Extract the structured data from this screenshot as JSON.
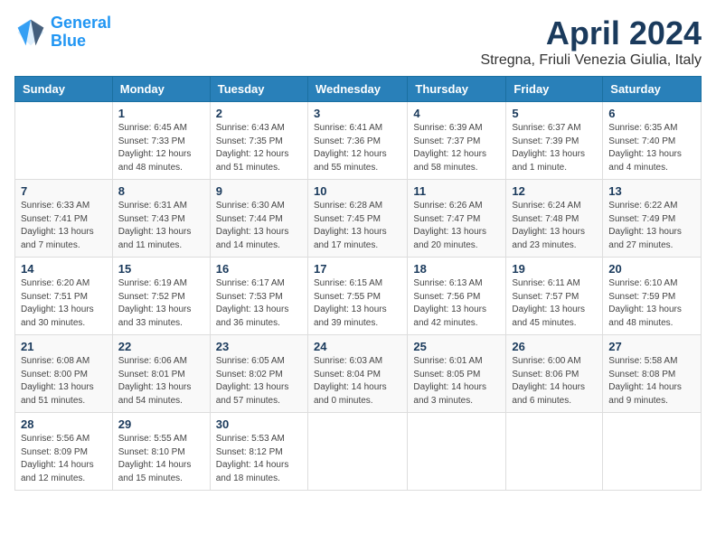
{
  "header": {
    "logo_line1": "General",
    "logo_line2": "Blue",
    "month_title": "April 2024",
    "subtitle": "Stregna, Friuli Venezia Giulia, Italy"
  },
  "weekdays": [
    "Sunday",
    "Monday",
    "Tuesday",
    "Wednesday",
    "Thursday",
    "Friday",
    "Saturday"
  ],
  "weeks": [
    [
      {
        "day": "",
        "sunrise": "",
        "sunset": "",
        "daylight": ""
      },
      {
        "day": "1",
        "sunrise": "Sunrise: 6:45 AM",
        "sunset": "Sunset: 7:33 PM",
        "daylight": "Daylight: 12 hours and 48 minutes."
      },
      {
        "day": "2",
        "sunrise": "Sunrise: 6:43 AM",
        "sunset": "Sunset: 7:35 PM",
        "daylight": "Daylight: 12 hours and 51 minutes."
      },
      {
        "day": "3",
        "sunrise": "Sunrise: 6:41 AM",
        "sunset": "Sunset: 7:36 PM",
        "daylight": "Daylight: 12 hours and 55 minutes."
      },
      {
        "day": "4",
        "sunrise": "Sunrise: 6:39 AM",
        "sunset": "Sunset: 7:37 PM",
        "daylight": "Daylight: 12 hours and 58 minutes."
      },
      {
        "day": "5",
        "sunrise": "Sunrise: 6:37 AM",
        "sunset": "Sunset: 7:39 PM",
        "daylight": "Daylight: 13 hours and 1 minute."
      },
      {
        "day": "6",
        "sunrise": "Sunrise: 6:35 AM",
        "sunset": "Sunset: 7:40 PM",
        "daylight": "Daylight: 13 hours and 4 minutes."
      }
    ],
    [
      {
        "day": "7",
        "sunrise": "Sunrise: 6:33 AM",
        "sunset": "Sunset: 7:41 PM",
        "daylight": "Daylight: 13 hours and 7 minutes."
      },
      {
        "day": "8",
        "sunrise": "Sunrise: 6:31 AM",
        "sunset": "Sunset: 7:43 PM",
        "daylight": "Daylight: 13 hours and 11 minutes."
      },
      {
        "day": "9",
        "sunrise": "Sunrise: 6:30 AM",
        "sunset": "Sunset: 7:44 PM",
        "daylight": "Daylight: 13 hours and 14 minutes."
      },
      {
        "day": "10",
        "sunrise": "Sunrise: 6:28 AM",
        "sunset": "Sunset: 7:45 PM",
        "daylight": "Daylight: 13 hours and 17 minutes."
      },
      {
        "day": "11",
        "sunrise": "Sunrise: 6:26 AM",
        "sunset": "Sunset: 7:47 PM",
        "daylight": "Daylight: 13 hours and 20 minutes."
      },
      {
        "day": "12",
        "sunrise": "Sunrise: 6:24 AM",
        "sunset": "Sunset: 7:48 PM",
        "daylight": "Daylight: 13 hours and 23 minutes."
      },
      {
        "day": "13",
        "sunrise": "Sunrise: 6:22 AM",
        "sunset": "Sunset: 7:49 PM",
        "daylight": "Daylight: 13 hours and 27 minutes."
      }
    ],
    [
      {
        "day": "14",
        "sunrise": "Sunrise: 6:20 AM",
        "sunset": "Sunset: 7:51 PM",
        "daylight": "Daylight: 13 hours and 30 minutes."
      },
      {
        "day": "15",
        "sunrise": "Sunrise: 6:19 AM",
        "sunset": "Sunset: 7:52 PM",
        "daylight": "Daylight: 13 hours and 33 minutes."
      },
      {
        "day": "16",
        "sunrise": "Sunrise: 6:17 AM",
        "sunset": "Sunset: 7:53 PM",
        "daylight": "Daylight: 13 hours and 36 minutes."
      },
      {
        "day": "17",
        "sunrise": "Sunrise: 6:15 AM",
        "sunset": "Sunset: 7:55 PM",
        "daylight": "Daylight: 13 hours and 39 minutes."
      },
      {
        "day": "18",
        "sunrise": "Sunrise: 6:13 AM",
        "sunset": "Sunset: 7:56 PM",
        "daylight": "Daylight: 13 hours and 42 minutes."
      },
      {
        "day": "19",
        "sunrise": "Sunrise: 6:11 AM",
        "sunset": "Sunset: 7:57 PM",
        "daylight": "Daylight: 13 hours and 45 minutes."
      },
      {
        "day": "20",
        "sunrise": "Sunrise: 6:10 AM",
        "sunset": "Sunset: 7:59 PM",
        "daylight": "Daylight: 13 hours and 48 minutes."
      }
    ],
    [
      {
        "day": "21",
        "sunrise": "Sunrise: 6:08 AM",
        "sunset": "Sunset: 8:00 PM",
        "daylight": "Daylight: 13 hours and 51 minutes."
      },
      {
        "day": "22",
        "sunrise": "Sunrise: 6:06 AM",
        "sunset": "Sunset: 8:01 PM",
        "daylight": "Daylight: 13 hours and 54 minutes."
      },
      {
        "day": "23",
        "sunrise": "Sunrise: 6:05 AM",
        "sunset": "Sunset: 8:02 PM",
        "daylight": "Daylight: 13 hours and 57 minutes."
      },
      {
        "day": "24",
        "sunrise": "Sunrise: 6:03 AM",
        "sunset": "Sunset: 8:04 PM",
        "daylight": "Daylight: 14 hours and 0 minutes."
      },
      {
        "day": "25",
        "sunrise": "Sunrise: 6:01 AM",
        "sunset": "Sunset: 8:05 PM",
        "daylight": "Daylight: 14 hours and 3 minutes."
      },
      {
        "day": "26",
        "sunrise": "Sunrise: 6:00 AM",
        "sunset": "Sunset: 8:06 PM",
        "daylight": "Daylight: 14 hours and 6 minutes."
      },
      {
        "day": "27",
        "sunrise": "Sunrise: 5:58 AM",
        "sunset": "Sunset: 8:08 PM",
        "daylight": "Daylight: 14 hours and 9 minutes."
      }
    ],
    [
      {
        "day": "28",
        "sunrise": "Sunrise: 5:56 AM",
        "sunset": "Sunset: 8:09 PM",
        "daylight": "Daylight: 14 hours and 12 minutes."
      },
      {
        "day": "29",
        "sunrise": "Sunrise: 5:55 AM",
        "sunset": "Sunset: 8:10 PM",
        "daylight": "Daylight: 14 hours and 15 minutes."
      },
      {
        "day": "30",
        "sunrise": "Sunrise: 5:53 AM",
        "sunset": "Sunset: 8:12 PM",
        "daylight": "Daylight: 14 hours and 18 minutes."
      },
      {
        "day": "",
        "sunrise": "",
        "sunset": "",
        "daylight": ""
      },
      {
        "day": "",
        "sunrise": "",
        "sunset": "",
        "daylight": ""
      },
      {
        "day": "",
        "sunrise": "",
        "sunset": "",
        "daylight": ""
      },
      {
        "day": "",
        "sunrise": "",
        "sunset": "",
        "daylight": ""
      }
    ]
  ]
}
